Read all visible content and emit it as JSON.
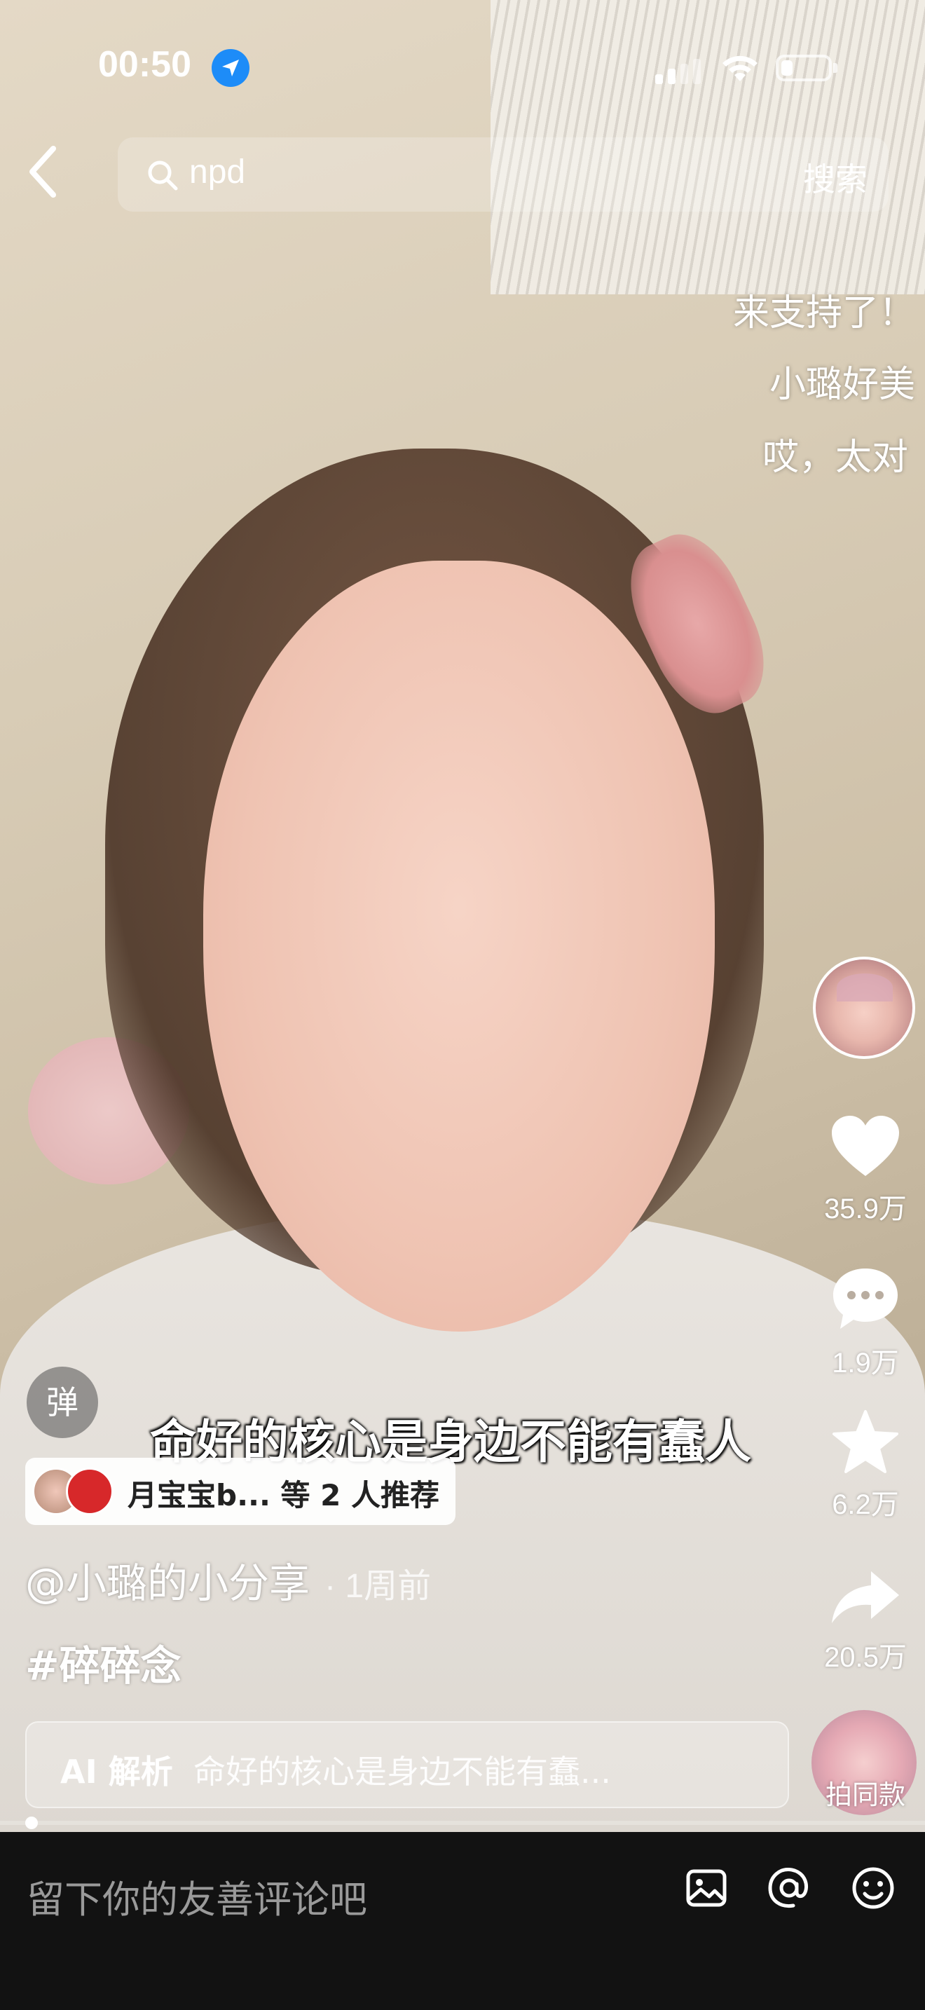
{
  "status_bar": {
    "time": "00:50",
    "icons": [
      "location-arrow-icon",
      "signal-icon",
      "wifi-icon",
      "battery-icon"
    ]
  },
  "search": {
    "query": "npd",
    "button_label": "搜索"
  },
  "danmaku": [
    "来支持了！",
    "小璐好美",
    "哎，太对"
  ],
  "actions": {
    "likes": "35.9万",
    "comments": "1.9万",
    "favorites": "6.2万",
    "shares": "20.5万",
    "music_label": "拍同款"
  },
  "danmaku_toggle_label": "弹",
  "subtitle": "命好的核心是身边不能有蠢人",
  "recommend": {
    "text": "月宝宝b... 等 2 人推荐"
  },
  "post": {
    "author": "@小璐的小分享",
    "time": "· 1周前",
    "hashtag": "#碎碎念"
  },
  "ai": {
    "label": "AI 解析",
    "text": "命好的核心是身边不能有蠢..."
  },
  "comment_bar": {
    "placeholder": "留下你的友善评论吧",
    "icons": [
      "image-icon",
      "at-mention-icon",
      "emoji-icon"
    ]
  },
  "colors": {
    "location_blue": "#1d8cf8",
    "comment_bar_bg": "#121212",
    "recommend_red": "#d7282a"
  }
}
